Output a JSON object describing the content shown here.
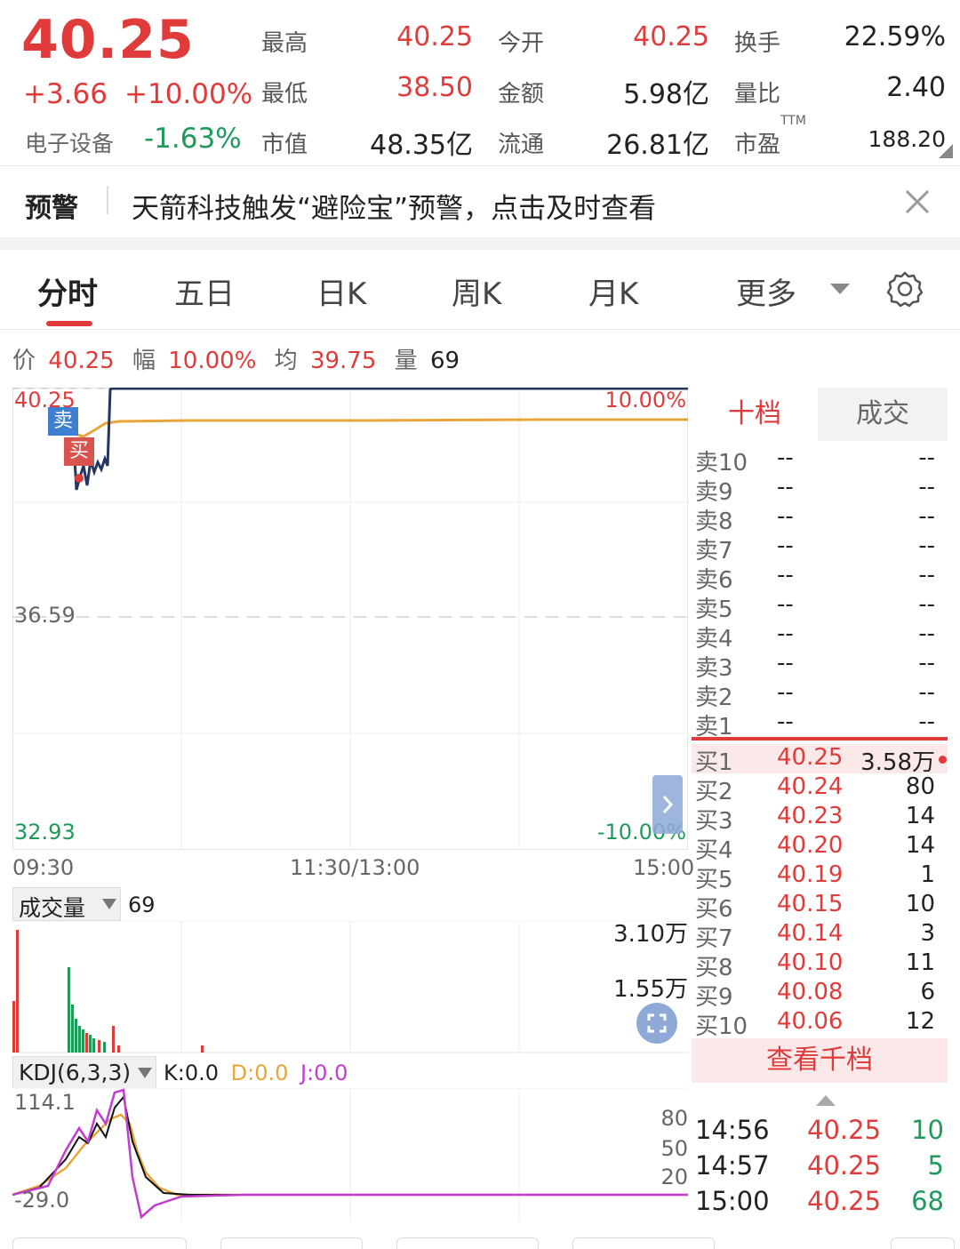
{
  "quote": {
    "price": "40.25",
    "change": "+3.66",
    "change_pct": "+10.00%",
    "sector": "电子设备",
    "sector_change": "-1.63%",
    "stats": [
      {
        "label": "最高",
        "value": "40.25",
        "color": "red"
      },
      {
        "label": "今开",
        "value": "40.25",
        "color": "red"
      },
      {
        "label": "换手",
        "value": "22.59%",
        "color": "dark"
      },
      {
        "label": "最低",
        "value": "38.50",
        "color": "red"
      },
      {
        "label": "金额",
        "value": "5.98亿",
        "color": "dark"
      },
      {
        "label": "量比",
        "value": "2.40",
        "color": "dark"
      },
      {
        "label": "市值",
        "value": "48.35亿",
        "color": "dark"
      },
      {
        "label": "流通",
        "value": "26.81亿",
        "color": "dark"
      },
      {
        "label": "市盈",
        "value": "188.20",
        "color": "dark"
      }
    ],
    "pe_superscript": "TTM"
  },
  "alert": {
    "tag": "预警",
    "message": "天箭科技触发“避险宝”预警，点击及时查看"
  },
  "tabs": [
    "分时",
    "五日",
    "日K",
    "周K",
    "月K",
    "更多"
  ],
  "info_line": {
    "price_label": "价",
    "price": "40.25",
    "range_label": "幅",
    "range": "10.00%",
    "avg_label": "均",
    "avg": "39.75",
    "vol_label": "量",
    "vol": "69"
  },
  "intraday": {
    "y_top": "40.25",
    "y_mid": "36.59",
    "y_bottom": "32.93",
    "pct_top": "10.00%",
    "pct_bottom": "-10.00%",
    "time_start": "09:30",
    "time_mid": "11:30/13:00",
    "time_end": "15:00",
    "sell_badge": "卖",
    "buy_badge": "买"
  },
  "volume": {
    "selector": "成交量",
    "value": "69",
    "max_label": "3.10万",
    "mid_label": "1.55万"
  },
  "kdj": {
    "selector": "KDJ(6,3,3)",
    "k": "K:0.0",
    "d": "D:0.0",
    "j": "J:0.0",
    "y_top": "114.1",
    "y_bottom": "-29.0",
    "levels": [
      "80",
      "50",
      "20"
    ]
  },
  "book": {
    "tab_active": "十档",
    "tab_other": "成交",
    "asks": [
      {
        "label": "卖10",
        "price": "--",
        "vol": "--"
      },
      {
        "label": "卖9",
        "price": "--",
        "vol": "--"
      },
      {
        "label": "卖8",
        "price": "--",
        "vol": "--"
      },
      {
        "label": "卖7",
        "price": "--",
        "vol": "--"
      },
      {
        "label": "卖6",
        "price": "--",
        "vol": "--"
      },
      {
        "label": "卖5",
        "price": "--",
        "vol": "--"
      },
      {
        "label": "卖4",
        "price": "--",
        "vol": "--"
      },
      {
        "label": "卖3",
        "price": "--",
        "vol": "--"
      },
      {
        "label": "卖2",
        "price": "--",
        "vol": "--"
      },
      {
        "label": "卖1",
        "price": "--",
        "vol": "--"
      }
    ],
    "bids": [
      {
        "label": "买1",
        "price": "40.25",
        "vol": "3.58万"
      },
      {
        "label": "买2",
        "price": "40.24",
        "vol": "80"
      },
      {
        "label": "买3",
        "price": "40.23",
        "vol": "14"
      },
      {
        "label": "买4",
        "price": "40.20",
        "vol": "14"
      },
      {
        "label": "买5",
        "price": "40.19",
        "vol": "1"
      },
      {
        "label": "买6",
        "price": "40.15",
        "vol": "10"
      },
      {
        "label": "买7",
        "price": "40.14",
        "vol": "3"
      },
      {
        "label": "买8",
        "price": "40.10",
        "vol": "11"
      },
      {
        "label": "买9",
        "price": "40.08",
        "vol": "6"
      },
      {
        "label": "买10",
        "price": "40.06",
        "vol": "12"
      }
    ],
    "more_button": "查看千档",
    "trades": [
      {
        "time": "14:56",
        "price": "40.25",
        "vol": "10"
      },
      {
        "time": "14:57",
        "price": "40.25",
        "vol": "5"
      },
      {
        "time": "15:00",
        "price": "40.25",
        "vol": "68"
      }
    ]
  },
  "colors": {
    "up": "#e03b3b",
    "down": "#1f9a5a",
    "price_line": "#24365f",
    "avg_line": "#e8a63a",
    "k_line": "#111111",
    "d_line": "#e8a63a",
    "j_line": "#c23ccf"
  }
}
